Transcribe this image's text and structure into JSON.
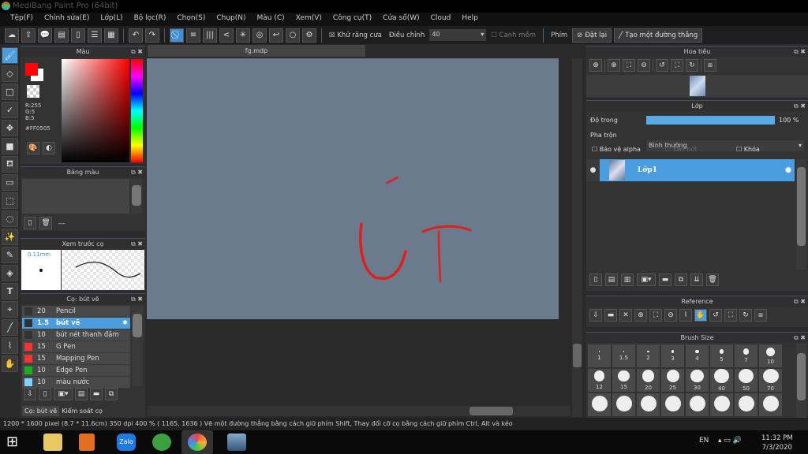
{
  "title": "MediBang Paint Pro (64bit)",
  "menu": [
    "Tệp(F)",
    "Chỉnh sửa(E)",
    "Lớp(L)",
    "Bộ lọc(R)",
    "Chọn(S)",
    "Chụp(N)",
    "Màu (C)",
    "Xem(V)",
    "Công cụ(T)",
    "Cửa sổ(W)",
    "Cloud",
    "Help"
  ],
  "toolbar": {
    "antialias": "Khử răng cưa",
    "adjust": "Điều chỉnh",
    "adjust_value": "40",
    "soft_edge": "Canh mềm",
    "keys": "Phím",
    "reset": "Đặt lại",
    "straight_line": "Tạo một đường thẳng"
  },
  "color_panel": {
    "title": "Màu",
    "r": "R:255",
    "g": "G:5",
    "b": "B:5",
    "hex": "#FF0505",
    "primary": "#ff0505",
    "secondary": "#ffffff"
  },
  "palette_panel": {
    "title": "Bảng màu",
    "value": "---"
  },
  "brush_preview": {
    "title": "Xem trước cọ",
    "size": "0.11mm"
  },
  "brush_panel": {
    "title": "Cọ: bút vẽ",
    "items": [
      {
        "size": "20",
        "name": "Pencil",
        "color": "#333333"
      },
      {
        "size": "1.5",
        "name": "bút vẽ",
        "color": "#333333"
      },
      {
        "size": "10",
        "name": "bút nét thanh đậm",
        "color": "#333333"
      },
      {
        "size": "15",
        "name": "G Pen",
        "color": "#ff3030"
      },
      {
        "size": "15",
        "name": "Mapping Pen",
        "color": "#ff3030"
      },
      {
        "size": "10",
        "name": "Edge Pen",
        "color": "#18b018"
      },
      {
        "size": "10",
        "name": "màu nước",
        "color": "#80d0ff"
      }
    ],
    "tabs": [
      "Cọ: bút vẽ",
      "Kiểm soát cọ"
    ]
  },
  "document": {
    "tab": "fg.mdp",
    "canvas_color": "#6b7a8c",
    "stroke_color": "#e02020"
  },
  "navigator": {
    "title": "Hoa tiêu"
  },
  "layer_panel": {
    "title": "Lớp",
    "opacity_label": "Độ trong",
    "opacity_value": "100 %",
    "opacity": 1.0,
    "blend_label": "Pha trộn",
    "blend_value": "Bình thường",
    "protect_alpha": "Bảo vệ alpha",
    "clip": "Xén bớt",
    "lock": "Khóa",
    "layers": [
      {
        "name": "Lớp1"
      }
    ]
  },
  "reference": {
    "title": "Reference"
  },
  "brush_size": {
    "title": "Brush Size",
    "sizes": [
      "1",
      "1.5",
      "2",
      "3",
      "4",
      "5",
      "7",
      "10",
      "12",
      "15",
      "20",
      "25",
      "30",
      "40",
      "50",
      "70"
    ]
  },
  "status": "1200 * 1600 pixel   (8.7 * 11.6cm)   350 dpi   400 %   ( 1165, 1636 )   Vẽ một đường thẳng bằng cách giữ phím Shift, Thay đổi cỡ cọ bằng cách giữ phím Ctrl, Alt và kéo",
  "taskbar": {
    "lang": "EN",
    "time": "11:32 PM",
    "date": "7/3/2020",
    "apps": [
      "file-explorer",
      "media-player",
      "zalo",
      "coc-coc",
      "medibang",
      "photos"
    ]
  }
}
